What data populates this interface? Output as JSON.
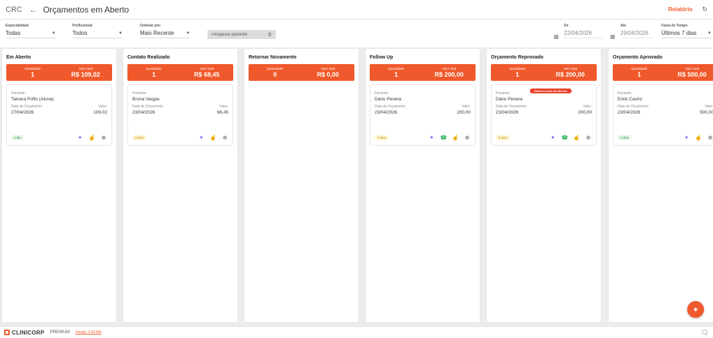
{
  "header": {
    "crc": "CRC",
    "title": "Orçamentos em Aberto",
    "report_label": "Relatório"
  },
  "filters": {
    "especialidade": {
      "label": "Especialidade",
      "value": "Todas"
    },
    "profissional": {
      "label": "Profissional",
      "value": "Todos"
    },
    "ordenar": {
      "label": "Ordenar por:",
      "value": "Mais Recente"
    },
    "search_placeholder": "Pesquisar paciente",
    "de": {
      "label": "De",
      "value": "22/04/2026"
    },
    "ate": {
      "label": "Até",
      "value": "29/04/2026"
    },
    "faixa": {
      "label": "Faixa de Tempo",
      "value": "Últimos 7 dias"
    }
  },
  "labels": {
    "quantidade": "Quantidade",
    "valor_total": "Valor total",
    "paciente": "Paciente:",
    "data_orcamento": "Data de Orçamento:",
    "valor": "Valor:"
  },
  "columns": [
    {
      "title": "Em Aberto",
      "qty": "1",
      "total": "R$ 109,02",
      "cards": [
        {
          "patient": "Tainara Poffo (Aluna)",
          "date": "27/04/2026",
          "value": "109,02",
          "badge": "1 dia",
          "badge_color": "green",
          "whatsapp": false
        }
      ]
    },
    {
      "title": "Contato Realizado",
      "qty": "1",
      "total": "R$ 68,45",
      "cards": [
        {
          "patient": "Bruna Vargas",
          "date": "23/04/2026",
          "value": "68,45",
          "badge": "5 dias",
          "badge_color": "yellow",
          "whatsapp": false
        }
      ]
    },
    {
      "title": "Retornar Novamente",
      "qty": "0",
      "total": "R$ 0,00",
      "cards": []
    },
    {
      "title": "Follow Up",
      "qty": "1",
      "total": "R$ 200,00",
      "cards": [
        {
          "patient": "Dário Pereira",
          "date": "23/04/2026",
          "value": "200,00",
          "badge": "5 dias",
          "badge_color": "yellow",
          "whatsapp": true
        }
      ]
    },
    {
      "title": "Orçamento Reprovado",
      "qty": "1",
      "total": "R$ 200,00",
      "cards": [
        {
          "patient": "Dário Pereira",
          "date": "23/04/2026",
          "value": "200,00",
          "badge": "5 dias",
          "badge_color": "yellow",
          "whatsapp": true,
          "tag": "Gabriel Lucas da Silveira"
        }
      ]
    },
    {
      "title": "Orçamento Aprovado",
      "qty": "1",
      "total": "R$ 500,00",
      "cards": [
        {
          "patient": "Erick Castro",
          "date": "23/04/2026",
          "value": "500,00",
          "badge": "2 dias",
          "badge_color": "green",
          "whatsapp": false
        }
      ]
    }
  ],
  "footer": {
    "brand": "CLINICORP",
    "plan": "PREMIUM",
    "version": "Versão: 2.34.30b"
  },
  "colors": {
    "accent": "#f0592b",
    "badge_green": "#2e8b3a",
    "badge_yellow": "#c28a00",
    "spark": "#7a5cf0",
    "whatsapp": "#1fae4a"
  },
  "icons": {
    "back": "arrow-left-icon",
    "refresh": "refresh-icon",
    "search": "search-icon",
    "calendar": "calendar-icon",
    "spark": "sparkle-icon",
    "whatsapp": "whatsapp-icon",
    "hand": "hand-pointer-icon",
    "plus": "plus-circle-icon",
    "chat": "chat-icon"
  }
}
